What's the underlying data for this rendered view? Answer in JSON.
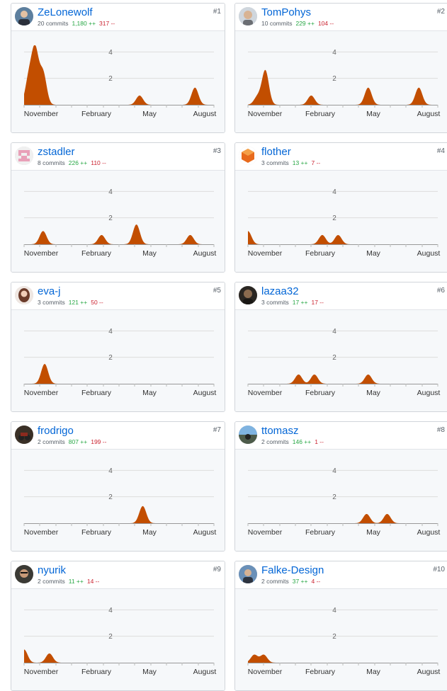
{
  "contributors": [
    {
      "rank": "#1",
      "username": "ZeLonewolf",
      "commits": "20 commits",
      "additions": "1,180 ++",
      "deletions": "317 --",
      "avatar_icon": "avatar-photo-portrait-icon"
    },
    {
      "rank": "#2",
      "username": "TomPohys",
      "commits": "10 commits",
      "additions": "229 ++",
      "deletions": "104 --",
      "avatar_icon": "avatar-photo-bald-man-icon"
    },
    {
      "rank": "#3",
      "username": "zstadler",
      "commits": "8 commits",
      "additions": "226 ++",
      "deletions": "110 --",
      "avatar_icon": "avatar-identicon-pink-icon"
    },
    {
      "rank": "#4",
      "username": "flother",
      "commits": "3 commits",
      "additions": "13 ++",
      "deletions": "7 --",
      "avatar_icon": "avatar-orange-hexagon-icon"
    },
    {
      "rank": "#5",
      "username": "eva-j",
      "commits": "3 commits",
      "additions": "121 ++",
      "deletions": "50 --",
      "avatar_icon": "avatar-photo-woman-icon"
    },
    {
      "rank": "#6",
      "username": "lazaa32",
      "commits": "3 commits",
      "additions": "17 ++",
      "deletions": "17 --",
      "avatar_icon": "avatar-photo-dark-icon"
    },
    {
      "rank": "#7",
      "username": "frodrigo",
      "commits": "2 commits",
      "additions": "807 ++",
      "deletions": "199 --",
      "avatar_icon": "avatar-photo-motorbike-icon"
    },
    {
      "rank": "#8",
      "username": "ttomasz",
      "commits": "2 commits",
      "additions": "146 ++",
      "deletions": "1 --",
      "avatar_icon": "avatar-photo-landscape-icon"
    },
    {
      "rank": "#9",
      "username": "nyurik",
      "commits": "2 commits",
      "additions": "11 ++",
      "deletions": "14 --",
      "avatar_icon": "avatar-photo-man-glasses-icon"
    },
    {
      "rank": "#10",
      "username": "Falke-Design",
      "commits": "2 commits",
      "additions": "37 ++",
      "deletions": "4 --",
      "avatar_icon": "avatar-photo-man-icon"
    }
  ],
  "colors": {
    "link": "#0366d6",
    "additions": "#28a745",
    "deletions": "#cb2431",
    "area_fill": "#c24e00",
    "chart_bg": "#f6f8fa",
    "gridline": "#dddddd"
  },
  "chart_data": [
    {
      "type": "area",
      "series_of": "ZeLonewolf",
      "x_months": [
        0,
        12
      ],
      "x_ticks": [
        "November",
        "February",
        "May",
        "August"
      ],
      "y_ticks": [
        2,
        4
      ],
      "ylim": [
        0,
        4.5
      ],
      "grid": true,
      "points": [
        [
          0.3,
          2
        ],
        [
          0.7,
          4
        ],
        [
          1.2,
          2.4
        ],
        [
          7.3,
          0.7
        ],
        [
          10.8,
          1.3
        ]
      ]
    },
    {
      "type": "area",
      "series_of": "TomPohys",
      "x_months": [
        0,
        12
      ],
      "x_ticks": [
        "November",
        "February",
        "May",
        "August"
      ],
      "y_ticks": [
        2,
        4
      ],
      "ylim": [
        0,
        4.5
      ],
      "grid": true,
      "points": [
        [
          0.6,
          0.6
        ],
        [
          1.1,
          2.6
        ],
        [
          4.0,
          0.7
        ],
        [
          7.6,
          1.3
        ],
        [
          10.8,
          1.3
        ]
      ]
    },
    {
      "type": "area",
      "series_of": "zstadler",
      "x_months": [
        0,
        12
      ],
      "x_ticks": [
        "November",
        "February",
        "May",
        "August"
      ],
      "y_ticks": [
        2,
        4
      ],
      "ylim": [
        0,
        4.5
      ],
      "grid": true,
      "points": [
        [
          1.2,
          1
        ],
        [
          4.9,
          0.7
        ],
        [
          7.1,
          1.5
        ],
        [
          10.5,
          0.7
        ]
      ]
    },
    {
      "type": "area",
      "series_of": "flother",
      "x_months": [
        0,
        12
      ],
      "x_ticks": [
        "November",
        "February",
        "May",
        "August"
      ],
      "y_ticks": [
        2,
        4
      ],
      "ylim": [
        0,
        4.5
      ],
      "grid": true,
      "points": [
        [
          0.0,
          1
        ],
        [
          4.7,
          0.7
        ],
        [
          5.7,
          0.7
        ]
      ]
    },
    {
      "type": "area",
      "series_of": "eva-j",
      "x_months": [
        0,
        12
      ],
      "x_ticks": [
        "November",
        "February",
        "May",
        "August"
      ],
      "y_ticks": [
        2,
        4
      ],
      "ylim": [
        0,
        4.5
      ],
      "grid": true,
      "points": [
        [
          1.3,
          1.5
        ]
      ]
    },
    {
      "type": "area",
      "series_of": "lazaa32",
      "x_months": [
        0,
        12
      ],
      "x_ticks": [
        "November",
        "February",
        "May",
        "August"
      ],
      "y_ticks": [
        2,
        4
      ],
      "ylim": [
        0,
        4.5
      ],
      "grid": true,
      "points": [
        [
          3.2,
          0.7
        ],
        [
          4.2,
          0.7
        ],
        [
          7.6,
          0.7
        ]
      ]
    },
    {
      "type": "area",
      "series_of": "frodrigo",
      "x_months": [
        0,
        12
      ],
      "x_ticks": [
        "November",
        "February",
        "May",
        "August"
      ],
      "y_ticks": [
        2,
        4
      ],
      "ylim": [
        0,
        4.5
      ],
      "grid": true,
      "points": [
        [
          7.5,
          1.3
        ]
      ]
    },
    {
      "type": "area",
      "series_of": "ttomasz",
      "x_months": [
        0,
        12
      ],
      "x_ticks": [
        "November",
        "February",
        "May",
        "August"
      ],
      "y_ticks": [
        2,
        4
      ],
      "ylim": [
        0,
        4.5
      ],
      "grid": true,
      "points": [
        [
          7.5,
          0.7
        ],
        [
          8.8,
          0.7
        ]
      ]
    },
    {
      "type": "area",
      "series_of": "nyurik",
      "x_months": [
        0,
        12
      ],
      "x_ticks": [
        "November",
        "February",
        "May",
        "August"
      ],
      "y_ticks": [
        2,
        4
      ],
      "ylim": [
        0,
        4.5
      ],
      "grid": true,
      "points": [
        [
          0.0,
          1
        ],
        [
          1.6,
          0.7
        ]
      ]
    },
    {
      "type": "area",
      "series_of": "Falke-Design",
      "x_months": [
        0,
        12
      ],
      "x_ticks": [
        "November",
        "February",
        "May",
        "August"
      ],
      "y_ticks": [
        2,
        4
      ],
      "ylim": [
        0,
        4.5
      ],
      "grid": true,
      "points": [
        [
          0.4,
          0.6
        ],
        [
          1.0,
          0.6
        ]
      ]
    }
  ]
}
